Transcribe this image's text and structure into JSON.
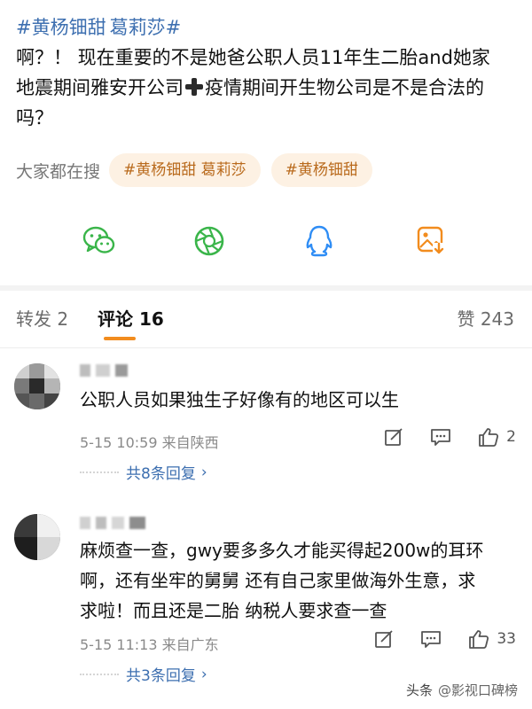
{
  "post": {
    "hashtags": [
      "#黄杨钿甜",
      "葛莉莎#"
    ],
    "line1": "啊？！ 现在重要的不是她爸公职人员11年生二胎and她家",
    "line2a": "地震期间雅安开公司",
    "line2b": "疫情期间开生物公司是不是合法的",
    "line3": "吗？"
  },
  "search": {
    "label": "大家都在搜",
    "chips": [
      "#黄杨钿甜 葛莉莎",
      "#黄杨钿甜"
    ]
  },
  "share": {
    "icons": [
      "wechat-icon",
      "moments-icon",
      "qq-icon",
      "save-image-icon"
    ],
    "colors": {
      "green": "#3ab54a",
      "blue": "#2f8df5",
      "orange": "#f28c1e"
    }
  },
  "tabs": {
    "repost": "转发 2",
    "comment": "评论 16",
    "like": "赞 243"
  },
  "comments": [
    {
      "text": "公职人员如果独生子好像有的地区可以生",
      "meta": "5-15 10:59 来自陕西",
      "likes": "2",
      "replies": "共8条回复"
    },
    {
      "line1": "麻烦查一查，gwy要多多久才能买得起200w的耳环",
      "line2": "啊，还有坐牢的舅舅 还有自己家里做海外生意，求",
      "line3": "求啦！而且还是二胎 纳税人要求查一查",
      "meta": "5-15 11:13 来自广东",
      "likes": "33",
      "replies": "共3条回复"
    }
  ],
  "watermark": {
    "brand": "头条",
    "account": "@影视口碑榜"
  }
}
